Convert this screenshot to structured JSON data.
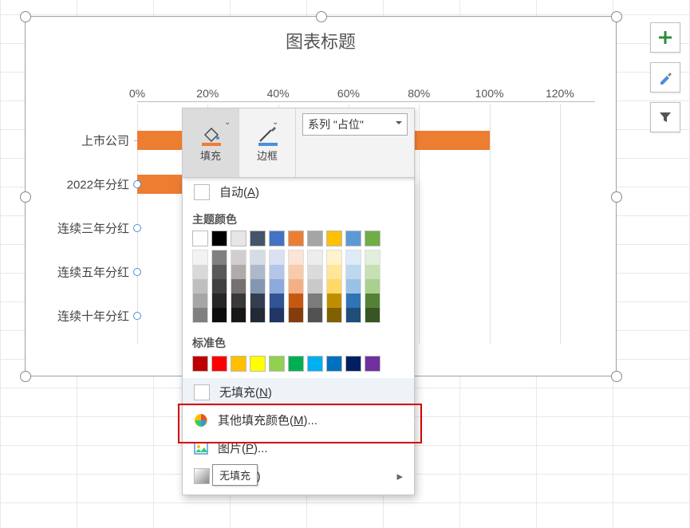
{
  "chart_data": {
    "type": "bar",
    "orientation": "horizontal",
    "title": "图表标题",
    "categories": [
      "上市公司",
      "2022年分红",
      "连续三年分红",
      "连续五年分红",
      "连续十年分红"
    ],
    "series": [
      {
        "name": "占位",
        "values": [
          100,
          74,
          0,
          0,
          0
        ]
      }
    ],
    "markers": [
      {
        "category_index": 1,
        "x": 0
      },
      {
        "category_index": 2,
        "x": 0
      },
      {
        "category_index": 3,
        "x": 0
      },
      {
        "category_index": 4,
        "x": 0
      }
    ],
    "xlim": [
      0,
      130
    ],
    "xticks": [
      0,
      20,
      40,
      60,
      80,
      100,
      120
    ],
    "xtick_labels": [
      "0%",
      "20%",
      "40%",
      "60%",
      "80%",
      "100%",
      "120%"
    ],
    "xlabel": "",
    "ylabel": "",
    "bar_color": "#ed7d31"
  },
  "side_buttons": {
    "add": "+",
    "format": "brush",
    "filter": "filter"
  },
  "mini_toolbar": {
    "fill": {
      "label": "填充",
      "icon": "fill-bucket"
    },
    "border": {
      "label": "边框",
      "icon": "border-pen"
    },
    "series_selector": {
      "value": "系列 \"占位\""
    }
  },
  "dropdown": {
    "auto": {
      "label": "自动(",
      "accel": "A",
      "tail": ")"
    },
    "theme_header": "主题颜色",
    "theme_colors": [
      "#ffffff",
      "#000000",
      "#e7e6e6",
      "#44546a",
      "#4472c4",
      "#ed7d31",
      "#a5a5a5",
      "#ffc000",
      "#5b9bd5",
      "#70ad47"
    ],
    "theme_shades": [
      [
        "#f2f2f2",
        "#d9d9d9",
        "#bfbfbf",
        "#a6a6a6",
        "#808080"
      ],
      [
        "#808080",
        "#595959",
        "#404040",
        "#262626",
        "#0d0d0d"
      ],
      [
        "#d0cecf",
        "#afabab",
        "#767171",
        "#3b3838",
        "#181717"
      ],
      [
        "#d6dce5",
        "#adb9ca",
        "#8497b0",
        "#333f50",
        "#222a35"
      ],
      [
        "#d9e1f2",
        "#b4c6e7",
        "#8ea9db",
        "#305496",
        "#203764"
      ],
      [
        "#fce4d6",
        "#f8cbad",
        "#f4b084",
        "#c65911",
        "#843c0c"
      ],
      [
        "#ededed",
        "#dbdbdb",
        "#c9c9c9",
        "#7b7b7b",
        "#525252"
      ],
      [
        "#fff2cc",
        "#ffe699",
        "#ffd966",
        "#bf8f00",
        "#806000"
      ],
      [
        "#ddebf7",
        "#bdd7ee",
        "#9bc2e6",
        "#2f75b5",
        "#1f4e78"
      ],
      [
        "#e2efda",
        "#c6e0b4",
        "#a9d08e",
        "#548235",
        "#375623"
      ]
    ],
    "standard_header": "标准色",
    "standard_colors": [
      "#c00000",
      "#ff0000",
      "#ffc000",
      "#ffff00",
      "#92d050",
      "#00b050",
      "#00b0f0",
      "#0070c0",
      "#002060",
      "#7030a0"
    ],
    "no_fill": {
      "label": "无填充(",
      "accel": "N",
      "tail": ")"
    },
    "more_colors": {
      "label": "其他填充颜色(",
      "accel": "M",
      "tail": ")..."
    },
    "picture": {
      "label": "图片(",
      "accel": "P",
      "tail": ")..."
    },
    "gradient": {
      "label": "渐变(",
      "accel": "G",
      "tail": ")"
    }
  },
  "tooltip": "无填充"
}
